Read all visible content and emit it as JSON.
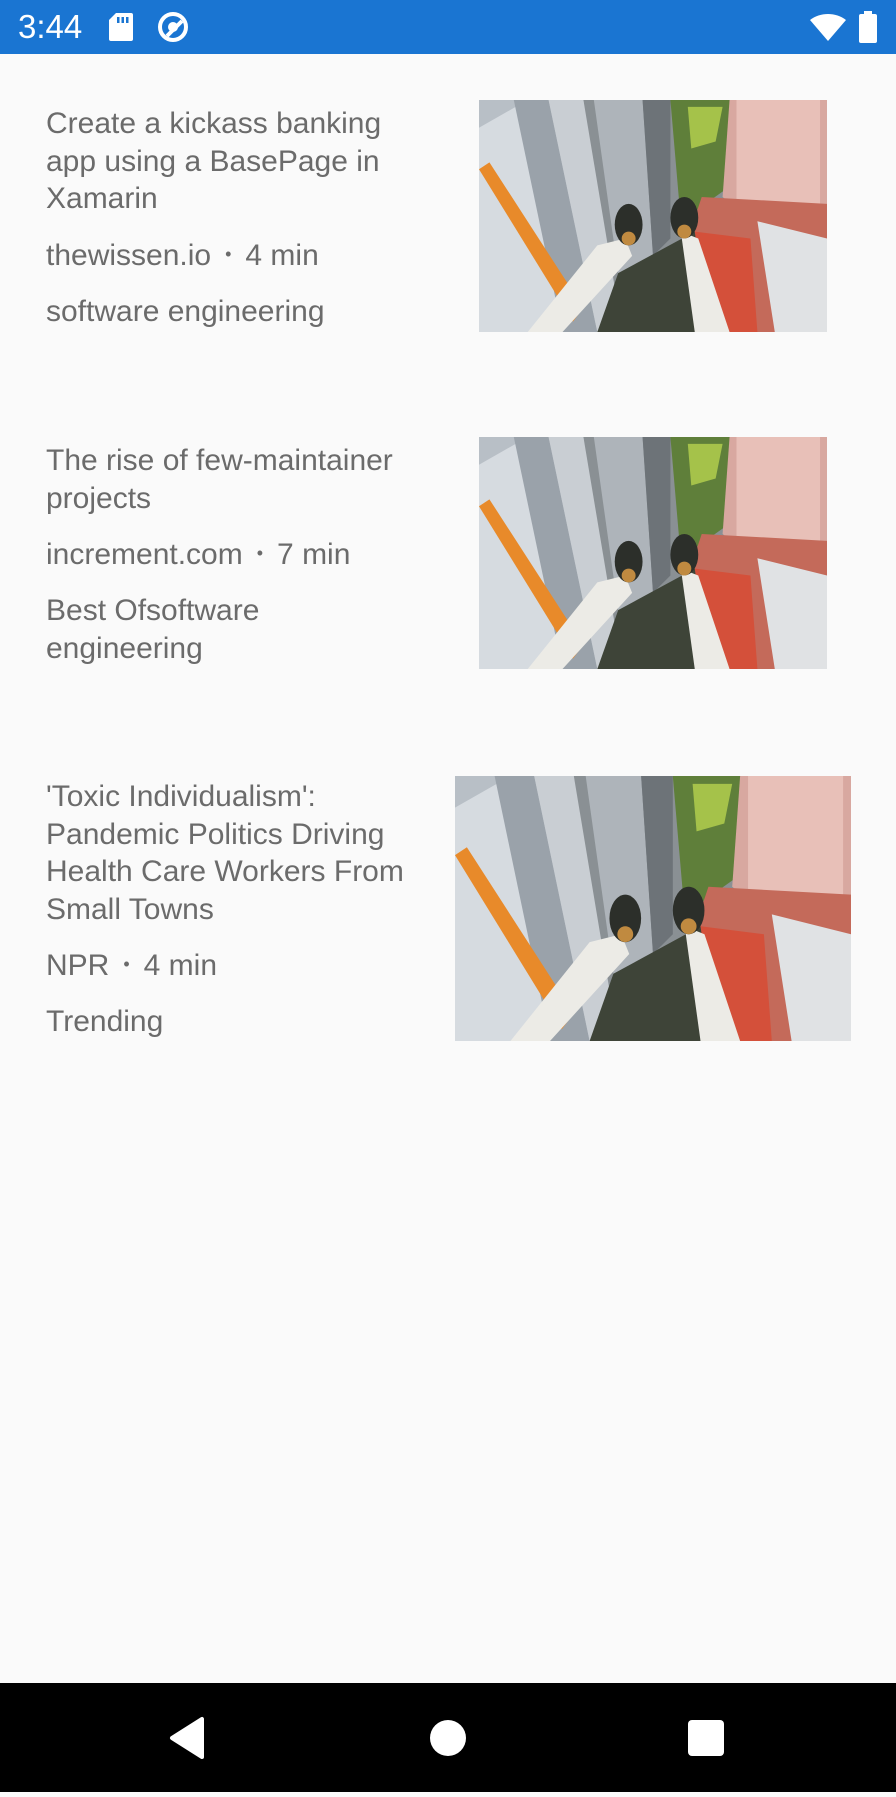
{
  "status_bar": {
    "time": "3:44",
    "icons": [
      "sd-card-icon",
      "vpn-icon",
      "wifi-icon",
      "battery-icon"
    ],
    "background": "#1a75d2"
  },
  "articles": [
    {
      "title": "Create a kickass banking app using a BasePage in Xamarin",
      "source": "thewissen.io",
      "separator": "•",
      "read_time": "4 min",
      "tag": "software engineering"
    },
    {
      "title": "The rise of few-maintainer projects",
      "source": "increment.com",
      "separator": "•",
      "read_time": "7 min",
      "tag": "Best Ofsoftware engineering"
    },
    {
      "title": "'Toxic Individualism': Pandemic Politics Driving Health Care Workers From Small Towns",
      "source": "NPR",
      "separator": "•",
      "read_time": "4 min",
      "tag": "Trending"
    }
  ],
  "nav_bar": {
    "buttons": [
      "back-icon",
      "home-icon",
      "recents-icon"
    ]
  },
  "colors": {
    "text": "#6b6b6b",
    "background": "#fafafa"
  }
}
